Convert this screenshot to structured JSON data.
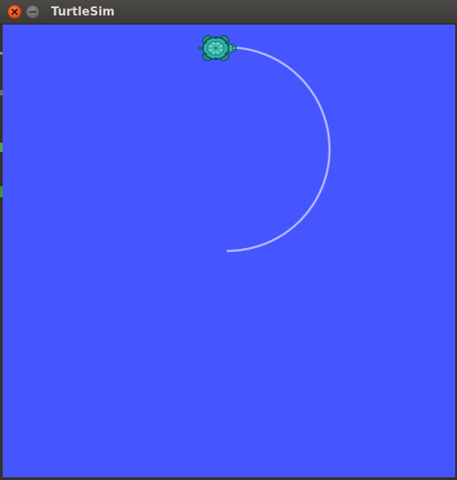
{
  "window": {
    "title": "TurtleSim"
  },
  "canvas": {
    "background": "#4556ff",
    "pen_color": "#b3b8ff",
    "turtle": {
      "shell_color": "#2fb3a6",
      "outline_color": "#0d4a4a",
      "icon": "turtle-icon"
    }
  },
  "colors": {
    "titlebar": "#3c3b37",
    "close_button": "#e2521d",
    "minimize_button": "#6b6a65",
    "title_text": "#dfdbd2"
  }
}
